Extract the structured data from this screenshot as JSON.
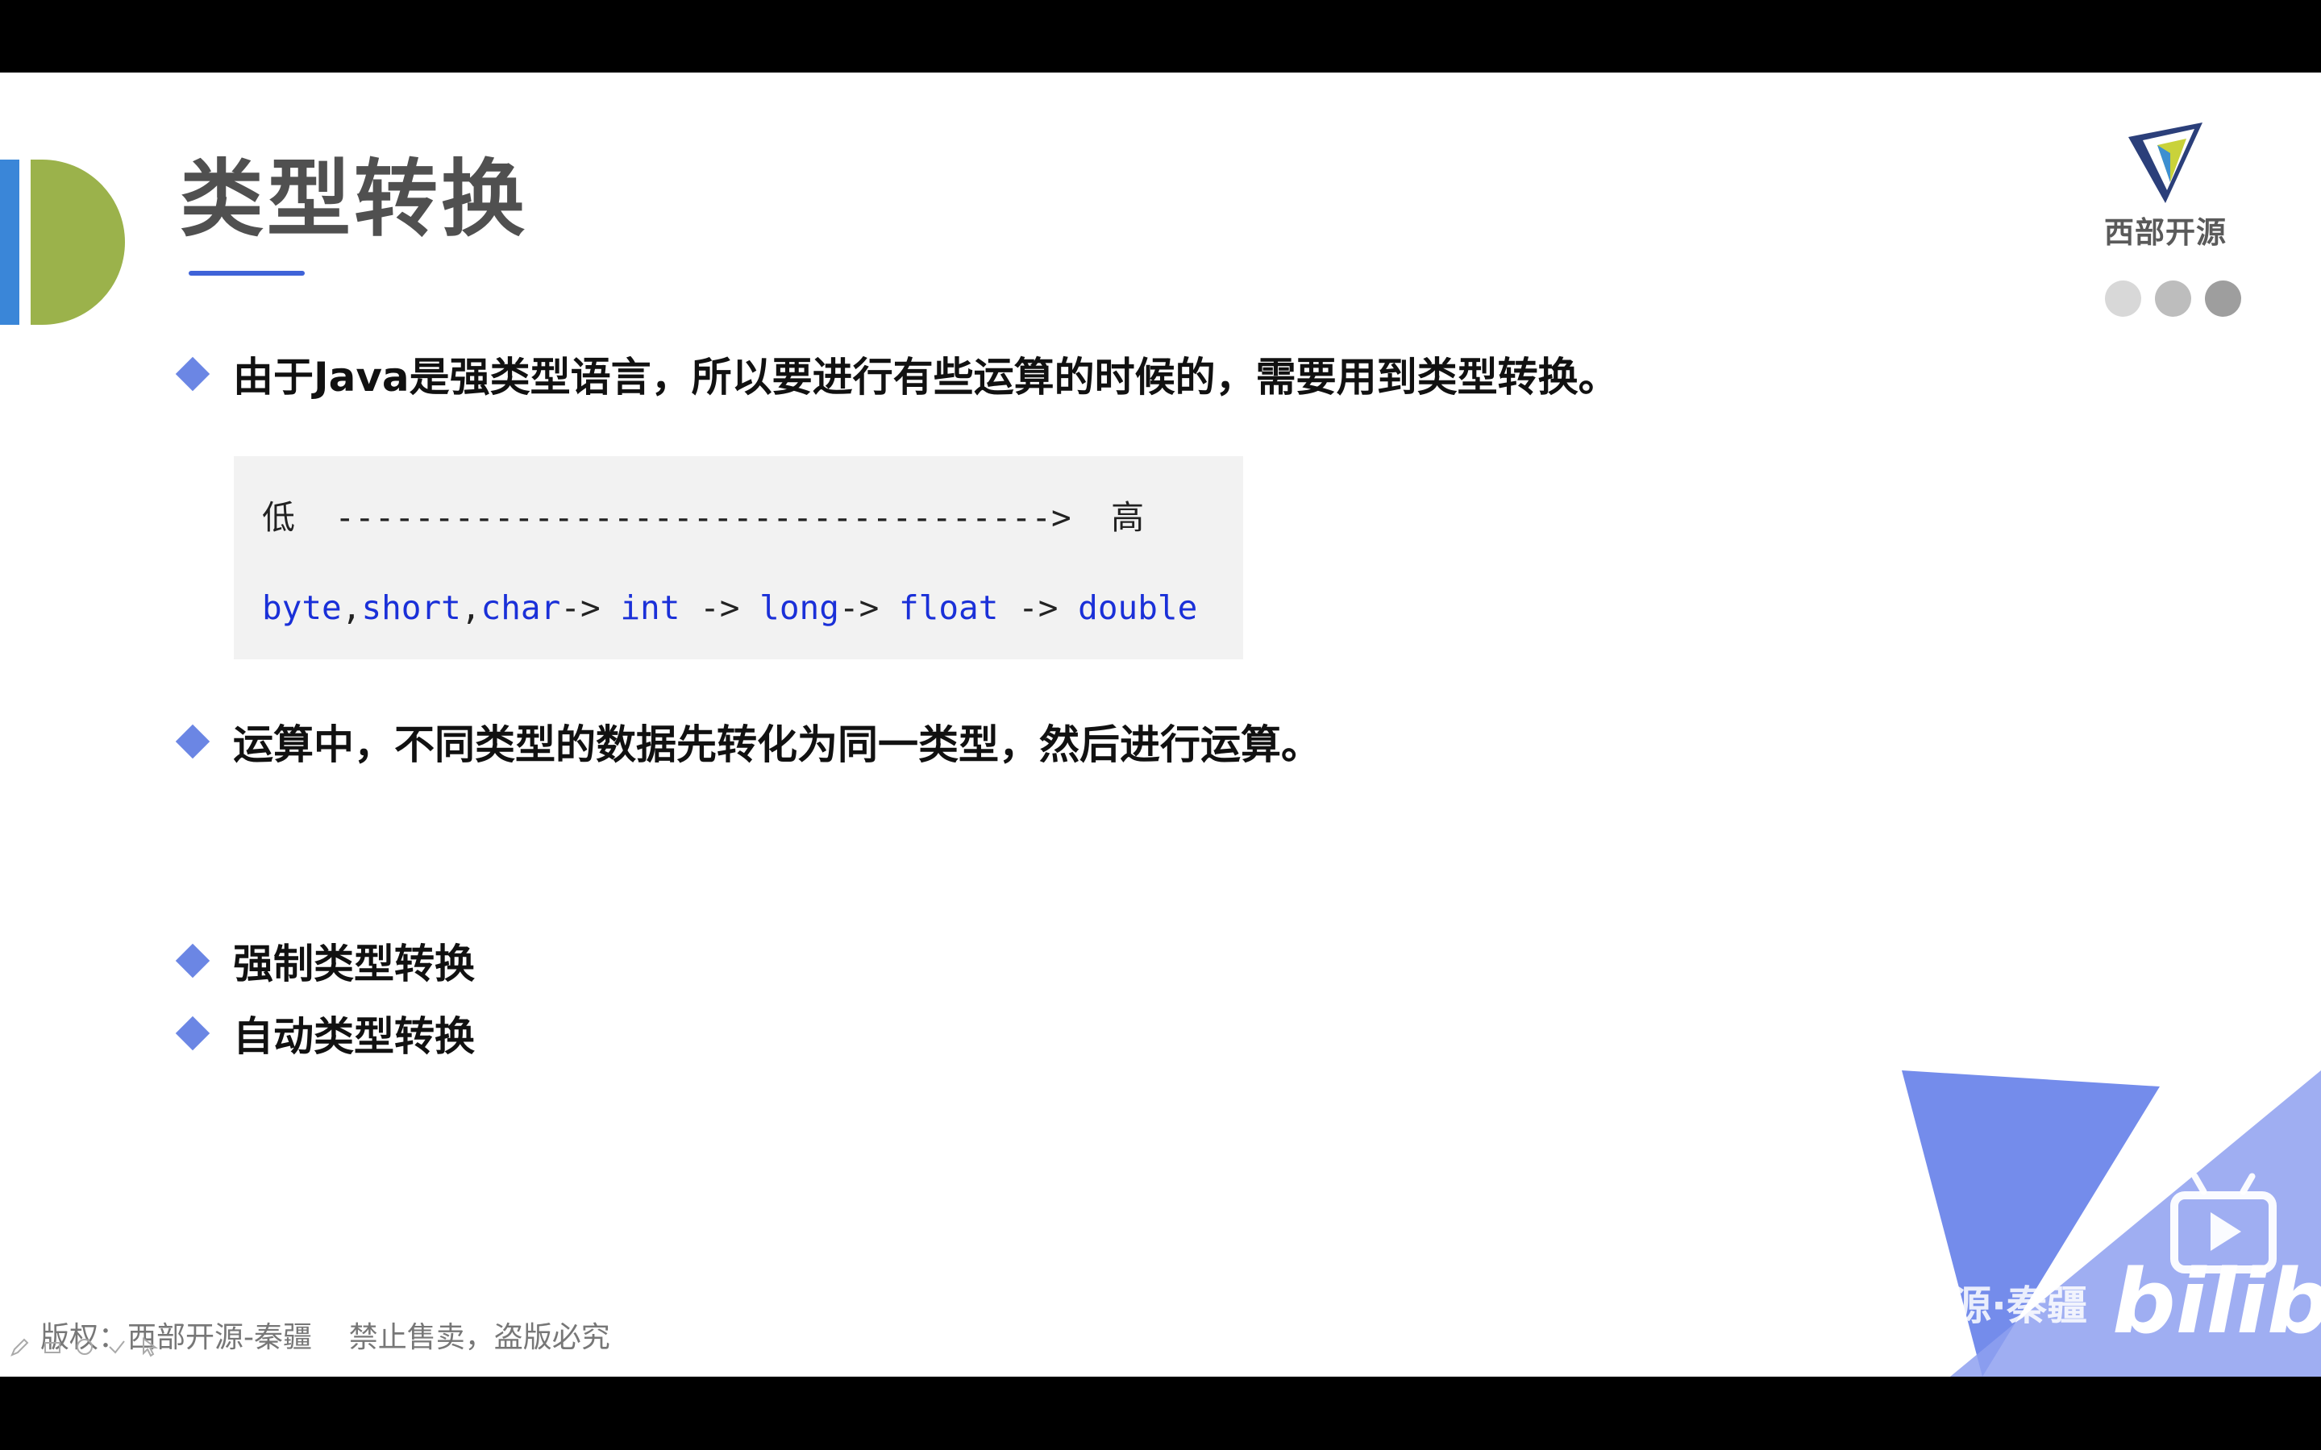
{
  "slide": {
    "title": "类型转换",
    "brand_name": "西部开源",
    "bullets": [
      "由于Java是强类型语言，所以要进行有些运算的时候的，需要用到类型转换。",
      "运算中，不同类型的数据先转化为同一类型，然后进行运算。",
      "强制类型转换",
      "自动类型转换"
    ],
    "code": {
      "line1_low": "低",
      "line1_arrow": "------------------------------------>",
      "line1_high": "高",
      "types": [
        "byte",
        ",",
        "short",
        ",",
        "char",
        "->",
        "int",
        "->",
        "long",
        "->",
        "float",
        "->",
        "double"
      ]
    },
    "footer": "版权：西部开源-秦疆    禁止售卖，盗版必究",
    "watermark": "西部开源·秦疆",
    "bilibili": "bilibili"
  },
  "colors": {
    "accent_blue": "#3f63d8",
    "diamond": "#6b86e4",
    "code_keyword": "#1a30d8",
    "logo_green": "#9bb24b",
    "logo_blue": "#3a86d8",
    "corner_blue": "#6d86ea"
  },
  "icons": [
    "pen-icon",
    "eraser-icon",
    "undo-icon",
    "check-icon",
    "pointer-icon",
    "brand-logo-icon",
    "bilibili-tv-icon"
  ]
}
